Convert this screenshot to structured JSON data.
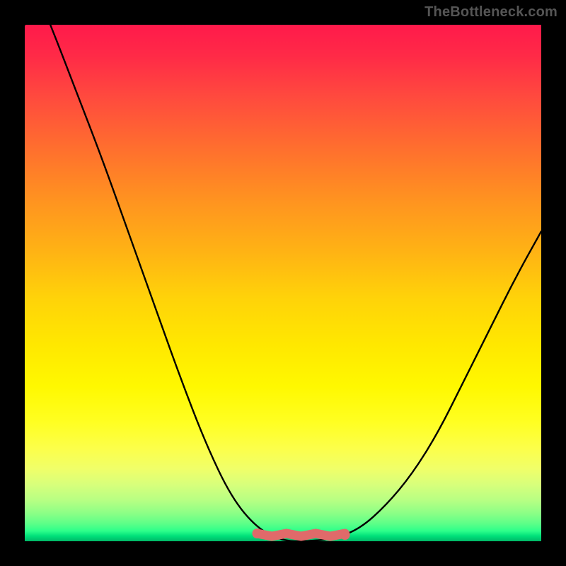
{
  "watermark": "TheBottleneck.com",
  "chart_data": {
    "type": "line",
    "title": "",
    "xlabel": "",
    "ylabel": "",
    "x": [
      0.0,
      0.05,
      0.1,
      0.15,
      0.2,
      0.25,
      0.3,
      0.35,
      0.4,
      0.45,
      0.5,
      0.55,
      0.6,
      0.65,
      0.7,
      0.75,
      0.8,
      0.85,
      0.9,
      0.95,
      1.0
    ],
    "values": [
      1.12,
      1.0,
      0.87,
      0.74,
      0.6,
      0.46,
      0.32,
      0.19,
      0.085,
      0.025,
      0.0,
      0.0,
      0.005,
      0.025,
      0.07,
      0.13,
      0.21,
      0.31,
      0.41,
      0.51,
      0.6
    ],
    "xlim": [
      0,
      1
    ],
    "ylim": [
      0,
      1
    ],
    "highlight_band": {
      "x": [
        0.45,
        0.62
      ],
      "y": 0.0
    },
    "background_gradient": {
      "type": "linear-vertical",
      "stops": [
        {
          "pos": 0.0,
          "color": "#ff1a4b"
        },
        {
          "pos": 0.5,
          "color": "#ffd309"
        },
        {
          "pos": 0.8,
          "color": "#ffff22"
        },
        {
          "pos": 1.0,
          "color": "#00b867"
        }
      ]
    }
  }
}
